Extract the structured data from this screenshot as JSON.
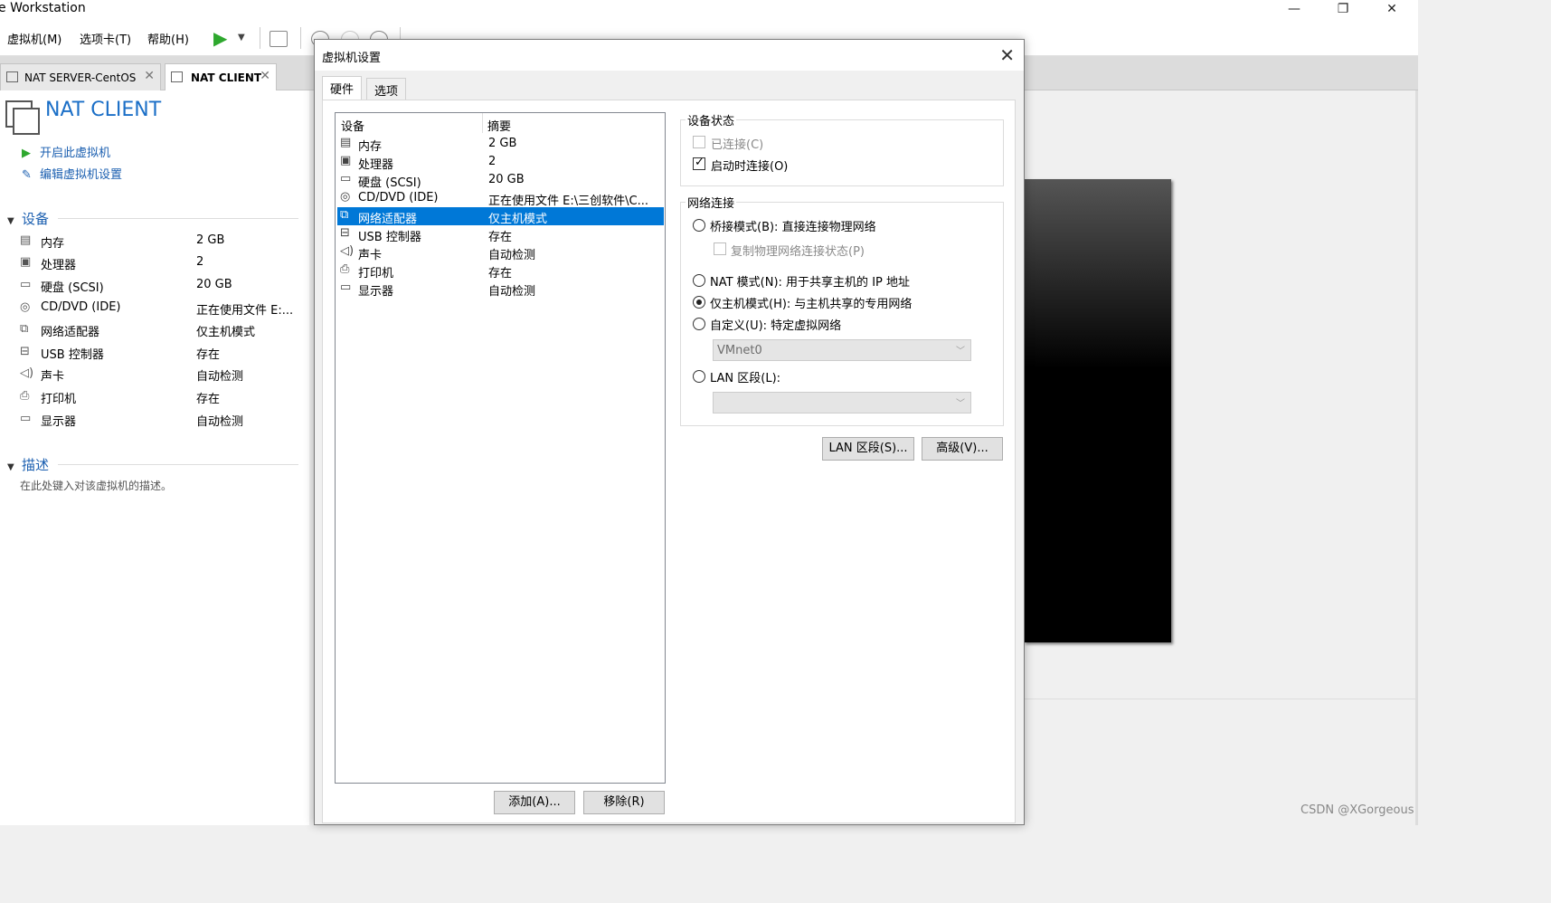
{
  "window": {
    "title": "e Workstation",
    "minimize": "—",
    "maximize": "❐",
    "close": "✕"
  },
  "menu": {
    "vm": "虚拟机(M)",
    "tabs": "选项卡(T)",
    "help": "帮助(H)"
  },
  "tabs": [
    {
      "label": "NAT SERVER-CentOS",
      "close": "✕"
    },
    {
      "label": "NAT CLIENT",
      "close": "✕"
    }
  ],
  "vm": {
    "name": "NAT CLIENT"
  },
  "actions": {
    "power_on": "开启此虚拟机",
    "edit_settings": "编辑虚拟机设置"
  },
  "devices_section": {
    "title": "设备",
    "items": [
      {
        "name": "内存",
        "value": "2 GB"
      },
      {
        "name": "处理器",
        "value": "2"
      },
      {
        "name": "硬盘 (SCSI)",
        "value": "20 GB"
      },
      {
        "name": "CD/DVD (IDE)",
        "value": "正在使用文件 E:..."
      },
      {
        "name": "网络适配器",
        "value": "仅主机模式"
      },
      {
        "name": "USB 控制器",
        "value": "存在"
      },
      {
        "name": "声卡",
        "value": "自动检测"
      },
      {
        "name": "打印机",
        "value": "存在"
      },
      {
        "name": "显示器",
        "value": "自动检测"
      }
    ]
  },
  "description_section": {
    "title": "描述",
    "placeholder": "在此处键入对该虚拟机的描述。"
  },
  "dialog": {
    "title": "虚拟机设置",
    "close": "✕",
    "tabs": {
      "hardware": "硬件",
      "options": "选项"
    },
    "list_headers": {
      "device": "设备",
      "summary": "摘要"
    },
    "list": [
      {
        "name": "内存",
        "value": "2 GB"
      },
      {
        "name": "处理器",
        "value": "2"
      },
      {
        "name": "硬盘 (SCSI)",
        "value": "20 GB"
      },
      {
        "name": "CD/DVD (IDE)",
        "value": "正在使用文件 E:\\三创软件\\C..."
      },
      {
        "name": "网络适配器",
        "value": "仅主机模式"
      },
      {
        "name": "USB 控制器",
        "value": "存在"
      },
      {
        "name": "声卡",
        "value": "自动检测"
      },
      {
        "name": "打印机",
        "value": "存在"
      },
      {
        "name": "显示器",
        "value": "自动检测"
      }
    ],
    "buttons": {
      "add": "添加(A)...",
      "remove": "移除(R)",
      "lan_segments": "LAN 区段(S)...",
      "advanced": "高级(V)..."
    },
    "device_status": {
      "title": "设备状态",
      "connected": "已连接(C)",
      "connect_at_power_on": "启动时连接(O)",
      "connected_checked": false,
      "connect_at_power_on_checked": true
    },
    "network": {
      "title": "网络连接",
      "bridged": "桥接模式(B): 直接连接物理网络",
      "replicate": "复制物理网络连接状态(P)",
      "nat": "NAT 模式(N): 用于共享主机的 IP 地址",
      "host_only": "仅主机模式(H): 与主机共享的专用网络",
      "custom": "自定义(U): 特定虚拟网络",
      "custom_value": "VMnet0",
      "lan_segment": "LAN 区段(L):",
      "lan_segment_value": "",
      "selected": "host_only"
    }
  },
  "watermark": "CSDN @XGorgeous"
}
